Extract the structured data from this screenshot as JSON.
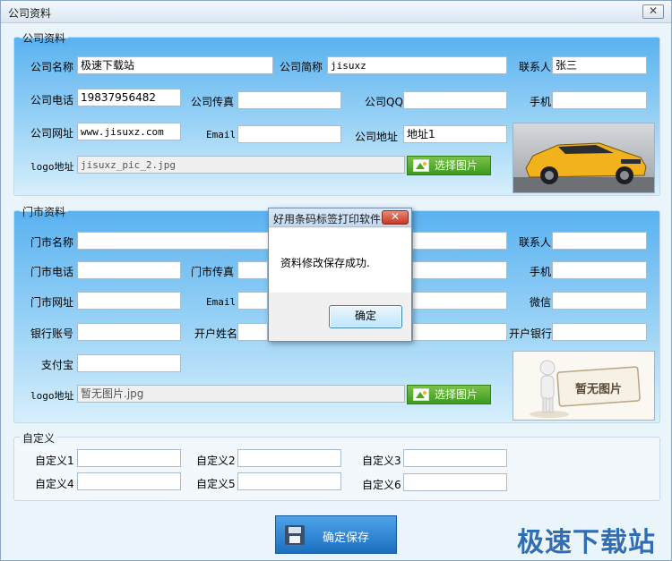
{
  "window": {
    "title": "公司资料",
    "close_glyph": "✕"
  },
  "company": {
    "legend": "公司资料",
    "name_label": "公司名称",
    "name_value": "极速下载站",
    "short_label": "公司简称",
    "short_value": "jisuxz",
    "contact_label": "联系人",
    "contact_value": "张三",
    "phone_label": "公司电话",
    "phone_value": "19837956482",
    "fax_label": "公司传真",
    "fax_value": "",
    "qq_label": "公司QQ",
    "qq_value": "",
    "mobile_label": "手机",
    "mobile_value": "",
    "site_label": "公司网址",
    "site_value": "www.jisuxz.com",
    "email_label": "Email",
    "email_value": "",
    "address_label": "公司地址",
    "address_value": "地址1",
    "logo_label": "logo地址",
    "logo_value": "jisuxz_pic_2.jpg",
    "pick_label": "选择图片"
  },
  "store": {
    "legend": "门市资料",
    "name_label": "门市名称",
    "contact_label": "联系人",
    "phone_label": "门市电话",
    "fax_label": "门市传真",
    "mobile_label": "手机",
    "site_label": "门市网址",
    "email_label": "Email",
    "wechat_label": "微信",
    "account_label": "银行账号",
    "holder_label": "开户姓名",
    "bank_label": "开户银行",
    "alipay_label": "支付宝",
    "logo_label": "logo地址",
    "logo_value": "暂无图片.jpg",
    "pick_label": "选择图片",
    "no_image_text": "暂无图片"
  },
  "custom": {
    "legend": "自定义",
    "labels": [
      "自定义1",
      "自定义2",
      "自定义3",
      "自定义4",
      "自定义5",
      "自定义6"
    ]
  },
  "dialog": {
    "title": "好用条码标签打印软件",
    "close_glyph": "✕",
    "message": "资料修改保存成功.",
    "ok_label": "确定"
  },
  "footer": {
    "save_label": "确定保存"
  },
  "watermark": "极速下载站",
  "colors": {
    "accent": "#3e9a1f",
    "panel_blue": "#5ab2f0",
    "save_blue": "#1c6fc0",
    "car_yellow": "#f2b21b"
  }
}
